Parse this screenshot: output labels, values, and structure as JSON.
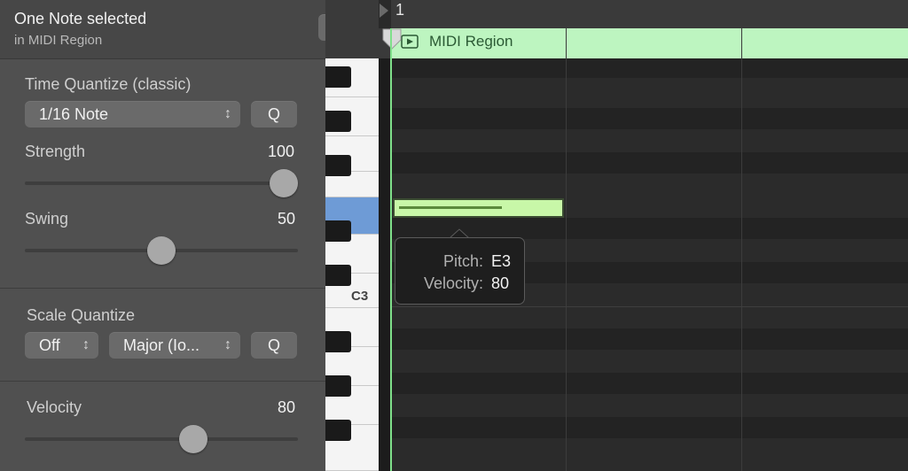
{
  "inspector": {
    "title": "One Note selected",
    "subtitle": "in MIDI Region",
    "time_quantize": {
      "label": "Time Quantize (classic)",
      "value": "1/16 Note",
      "q_label": "Q",
      "strength_label": "Strength",
      "strength_value": "100",
      "strength_level": 1.0,
      "swing_label": "Swing",
      "swing_value": "50",
      "swing_level": 0.5
    },
    "scale_quantize": {
      "label": "Scale Quantize",
      "root": "Off",
      "scale": "Major (Io...",
      "q_label": "Q"
    },
    "velocity": {
      "label": "Velocity",
      "value": "80",
      "level": 0.63
    }
  },
  "keyboard": {
    "c3_label": "C3"
  },
  "editor": {
    "ruler_bar": "1",
    "region_name": "MIDI Region",
    "tooltip": {
      "pitch_label": "Pitch:",
      "pitch_value": "E3",
      "velocity_label": "Velocity:",
      "velocity_value": "80"
    }
  },
  "colors": {
    "region": "#bdf5c0",
    "note": "#c8f7a8",
    "selected_key": "#6e9bd6",
    "playhead": "#7fe08a"
  }
}
